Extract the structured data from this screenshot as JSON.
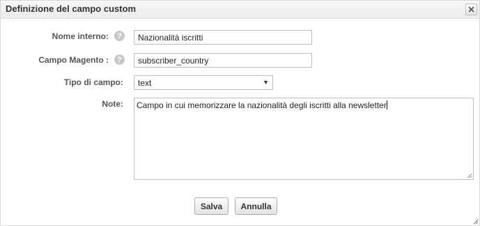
{
  "dialog": {
    "title": "Definizione del campo custom",
    "close_icon": "close-icon"
  },
  "form": {
    "internal_name": {
      "label": "Nome interno:",
      "value": "Nazionalità iscritti",
      "help_icon": "help-icon",
      "help_glyph": "?"
    },
    "magento_field": {
      "label": "Campo Magento :",
      "value": "subscriber_country",
      "help_icon": "help-icon",
      "help_glyph": "?"
    },
    "field_type": {
      "label": "Tipo di campo:",
      "selected": "text",
      "dropdown_icon": "caret-down-icon",
      "dropdown_glyph": "▼"
    },
    "notes": {
      "label": "Note:",
      "value": "Campo in cui memorizzare la nazionalità degli iscritti alla newsletter"
    }
  },
  "buttons": {
    "save": "Salva",
    "cancel": "Annulla"
  },
  "colors": {
    "titlebar": "#ececec",
    "border": "#bdbdbd",
    "label": "#555555",
    "help_icon": "#c8c8c8"
  }
}
